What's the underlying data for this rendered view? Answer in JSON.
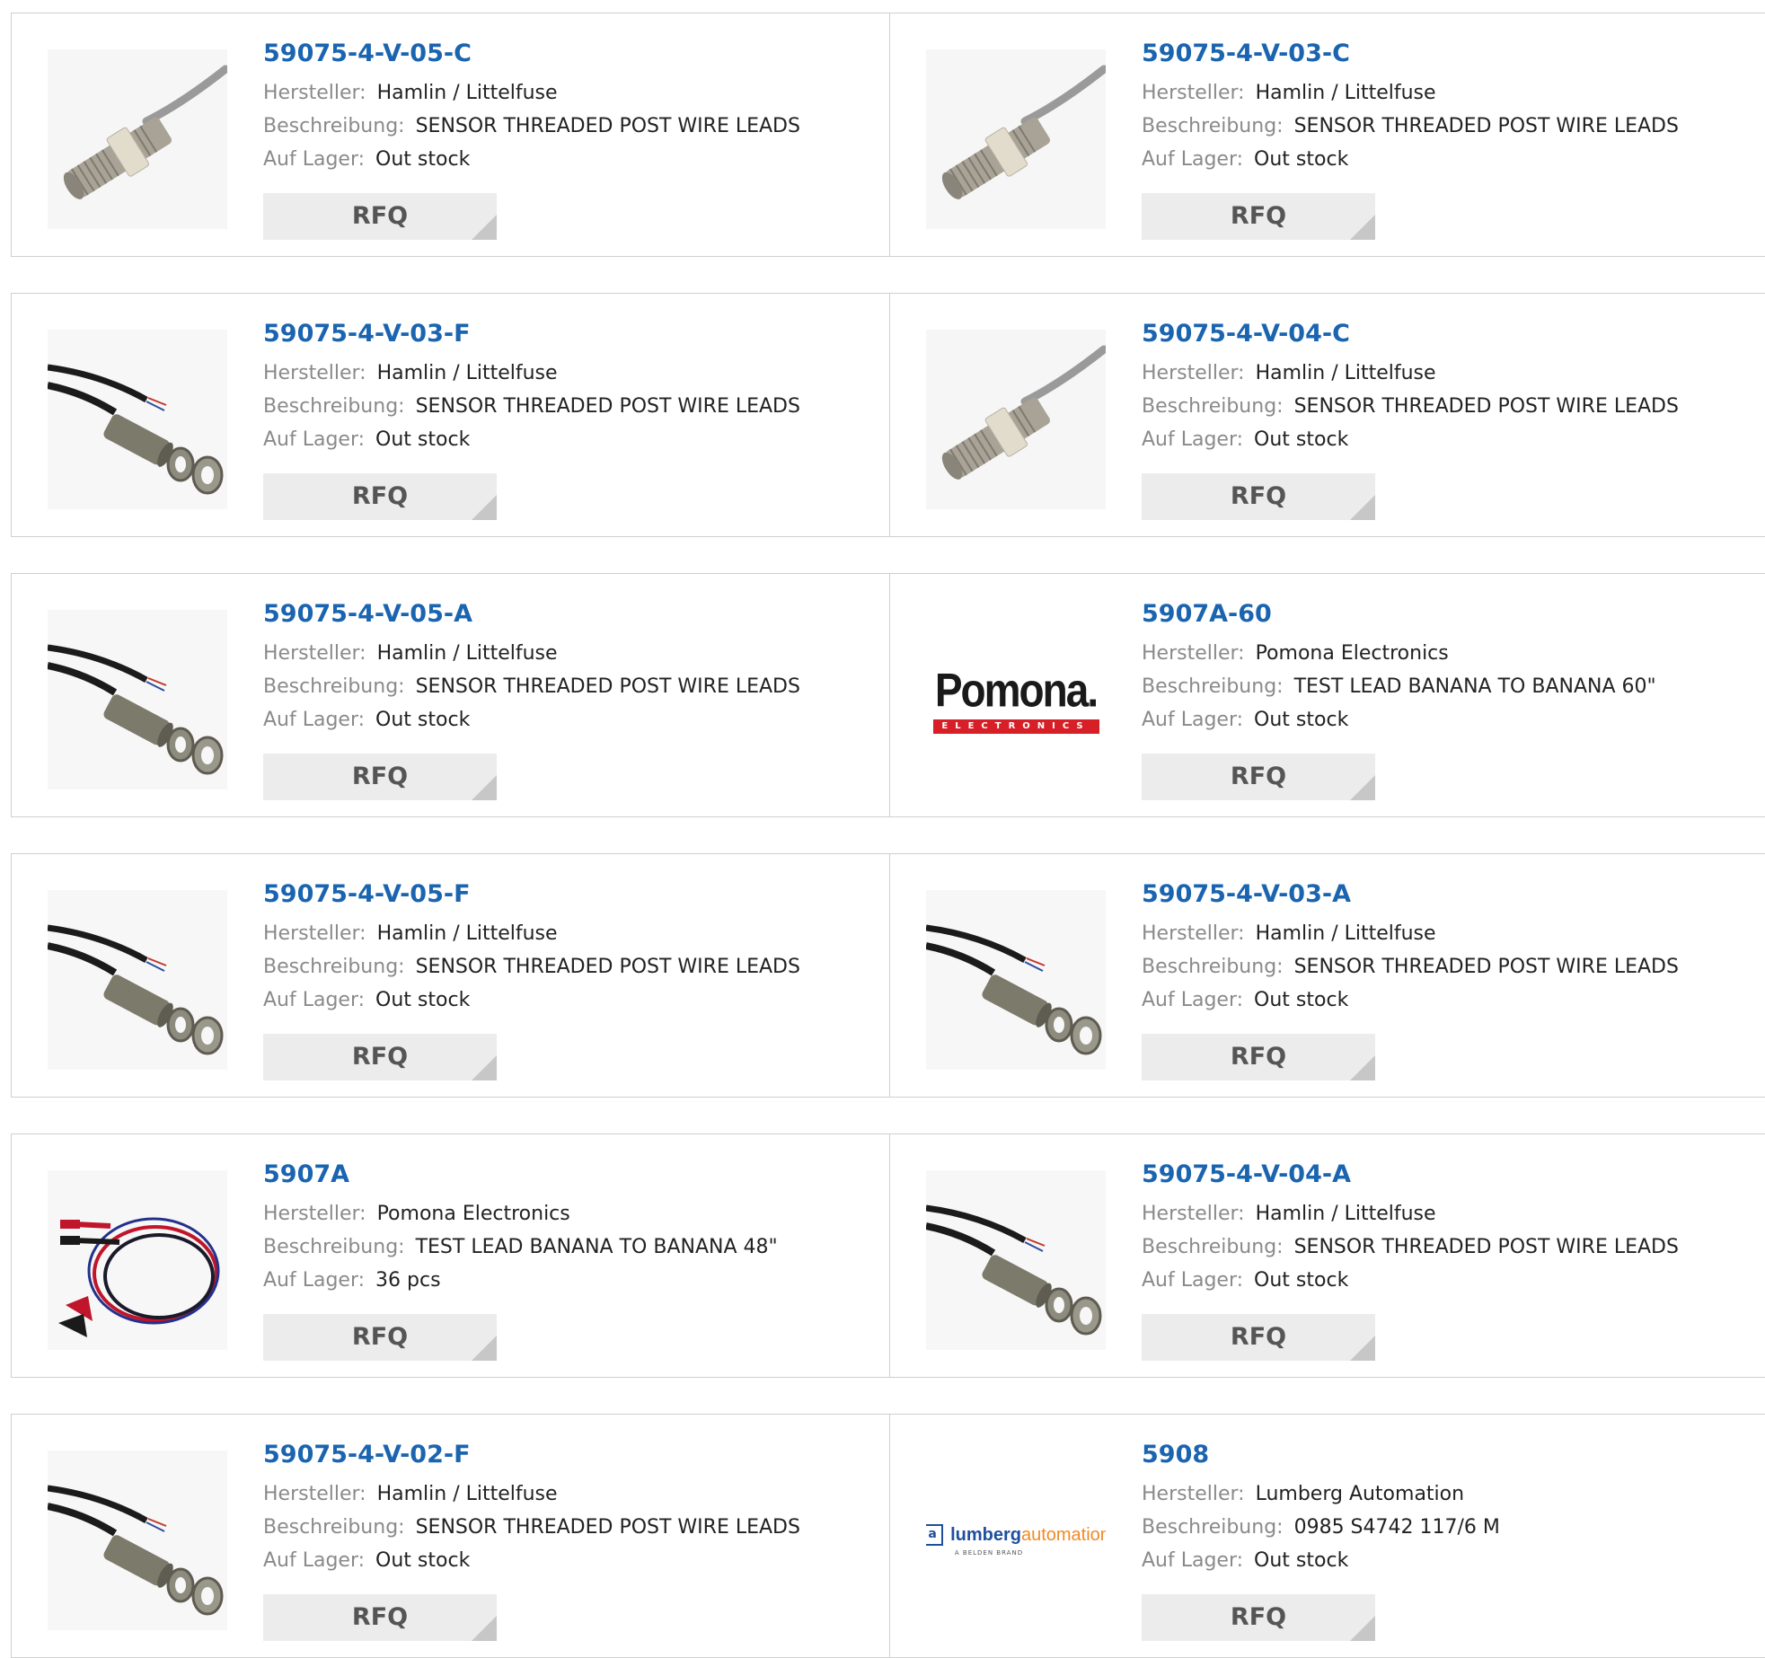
{
  "labels": {
    "manufacturer": "Hersteller:",
    "description": "Beschreibung:",
    "stock": "Auf Lager:",
    "rfq": "RFQ"
  },
  "rows": [
    [
      {
        "part": "59075-4-V-05-C",
        "manufacturer": "Hamlin / Littelfuse",
        "description": "SENSOR THREADED POST WIRE LEADS",
        "stock": "Out stock",
        "image": "threaded-sensor-gray"
      },
      {
        "part": "59075-4-V-03-C",
        "manufacturer": "Hamlin / Littelfuse",
        "description": "SENSOR THREADED POST WIRE LEADS",
        "stock": "Out stock",
        "image": "threaded-sensor-gray"
      }
    ],
    [
      {
        "part": "59075-4-V-03-F",
        "manufacturer": "Hamlin / Littelfuse",
        "description": "SENSOR THREADED POST WIRE LEADS",
        "stock": "Out stock",
        "image": "sensor-cable-nuts"
      },
      {
        "part": "59075-4-V-04-C",
        "manufacturer": "Hamlin / Littelfuse",
        "description": "SENSOR THREADED POST WIRE LEADS",
        "stock": "Out stock",
        "image": "threaded-sensor-gray"
      }
    ],
    [
      {
        "part": "59075-4-V-05-A",
        "manufacturer": "Hamlin / Littelfuse",
        "description": "SENSOR THREADED POST WIRE LEADS",
        "stock": "Out stock",
        "image": "sensor-cable-nuts"
      },
      {
        "part": "5907A-60",
        "manufacturer": "Pomona Electronics",
        "description": "TEST LEAD BANANA TO BANANA 60\"",
        "stock": "Out stock",
        "image": "pomona-logo",
        "logo_text": "Pomona.",
        "logo_sub": "ELECTRONICS"
      }
    ],
    [
      {
        "part": "59075-4-V-05-F",
        "manufacturer": "Hamlin / Littelfuse",
        "description": "SENSOR THREADED POST WIRE LEADS",
        "stock": "Out stock",
        "image": "sensor-cable-nuts"
      },
      {
        "part": "59075-4-V-03-A",
        "manufacturer": "Hamlin / Littelfuse",
        "description": "SENSOR THREADED POST WIRE LEADS",
        "stock": "Out stock",
        "image": "sensor-cable-nuts"
      }
    ],
    [
      {
        "part": "5907A",
        "manufacturer": "Pomona Electronics",
        "description": "TEST LEAD BANANA TO BANANA 48\"",
        "stock": "36 pcs",
        "image": "test-lead-coil"
      },
      {
        "part": "59075-4-V-04-A",
        "manufacturer": "Hamlin / Littelfuse",
        "description": "SENSOR THREADED POST WIRE LEADS",
        "stock": "Out stock",
        "image": "sensor-cable-nuts"
      }
    ],
    [
      {
        "part": "59075-4-V-02-F",
        "manufacturer": "Hamlin / Littelfuse",
        "description": "SENSOR THREADED POST WIRE LEADS",
        "stock": "Out stock",
        "image": "sensor-cable-nuts"
      },
      {
        "part": "5908",
        "manufacturer": "Lumberg Automation",
        "description": "0985 S4742 117/6 M",
        "stock": "Out stock",
        "image": "lumberg-logo",
        "logo_text_a": "lumberg",
        "logo_text_b": "automation",
        "logo_sub": "A BELDEN BRAND"
      }
    ]
  ],
  "colors": {
    "link": "#1a64b0",
    "label": "#8a8a8a",
    "value": "#222222",
    "rfq_bg": "#ececec",
    "border": "#cfcfcf"
  }
}
